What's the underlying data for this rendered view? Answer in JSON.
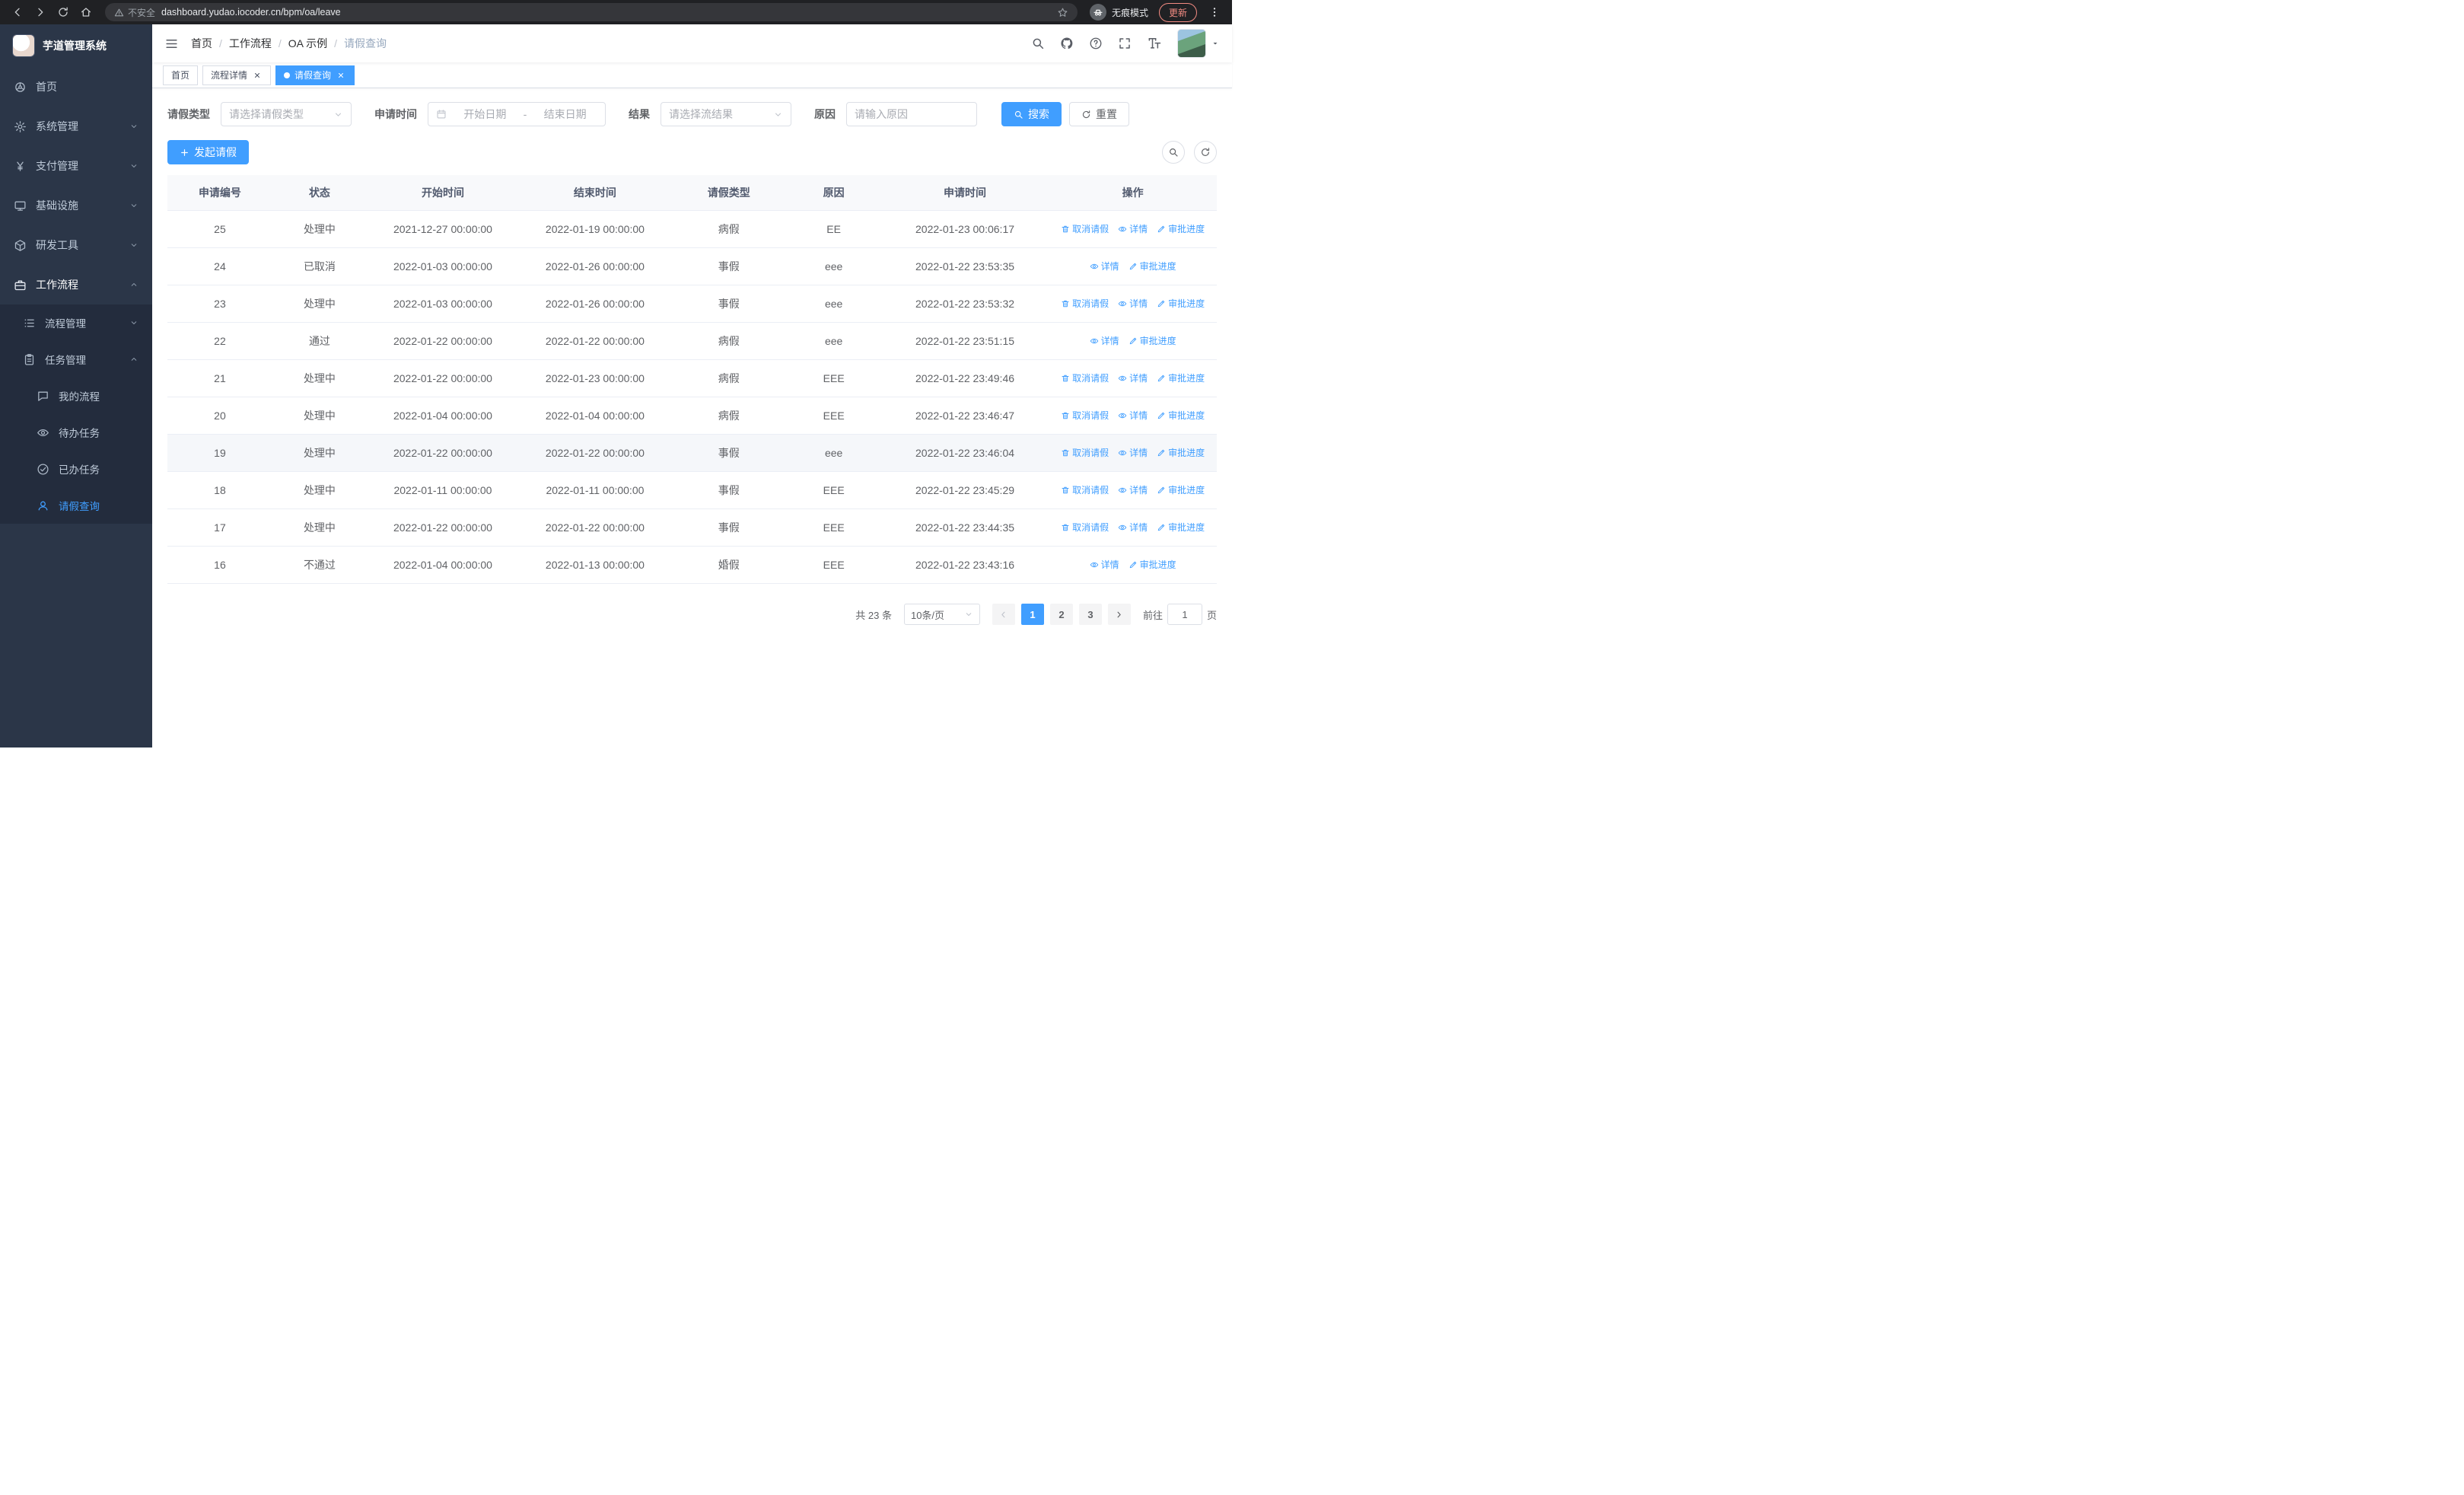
{
  "browser": {
    "security_label": "不安全",
    "url": "dashboard.yudao.iocoder.cn/bpm/oa/leave",
    "incognito_label": "无痕模式",
    "update_label": "更新"
  },
  "sidebar": {
    "title": "芋道管理系统",
    "items": [
      {
        "key": "home",
        "label": "首页",
        "icon": "wheel"
      },
      {
        "key": "system",
        "label": "系统管理",
        "icon": "gear",
        "chevron": "down"
      },
      {
        "key": "payment",
        "label": "支付管理",
        "icon": "yen",
        "chevron": "down"
      },
      {
        "key": "infra",
        "label": "基础设施",
        "icon": "monitor",
        "chevron": "down"
      },
      {
        "key": "devtools",
        "label": "研发工具",
        "icon": "box",
        "chevron": "down"
      },
      {
        "key": "workflow",
        "label": "工作流程",
        "icon": "briefcase",
        "chevron": "up",
        "open": true
      }
    ],
    "submenu": [
      {
        "key": "process-mgmt",
        "label": "流程管理",
        "icon": "list",
        "level": 2,
        "chevron": "down"
      },
      {
        "key": "task-mgmt",
        "label": "任务管理",
        "icon": "clipboard",
        "level": 2,
        "chevron": "up"
      },
      {
        "key": "my-process",
        "label": "我的流程",
        "icon": "chat",
        "level": 3
      },
      {
        "key": "todo-tasks",
        "label": "待办任务",
        "icon": "eye",
        "level": 3
      },
      {
        "key": "done-tasks",
        "label": "已办任务",
        "icon": "check",
        "level": 3
      },
      {
        "key": "leave-query",
        "label": "请假查询",
        "icon": "user",
        "level": 3,
        "active": true
      }
    ]
  },
  "header": {
    "breadcrumbs": [
      "首页",
      "工作流程",
      "OA 示例",
      "请假查询"
    ],
    "separator": "/"
  },
  "tabs": [
    {
      "key": "home",
      "label": "首页",
      "closable": false,
      "active": false
    },
    {
      "key": "process-detail",
      "label": "流程详情",
      "closable": true,
      "active": false
    },
    {
      "key": "leave-query",
      "label": "请假查询",
      "closable": true,
      "active": true
    }
  ],
  "filters": {
    "leave_type_label": "请假类型",
    "leave_type_placeholder": "请选择请假类型",
    "apply_time_label": "申请时间",
    "start_date_placeholder": "开始日期",
    "range_separator": "-",
    "end_date_placeholder": "结束日期",
    "result_label": "结果",
    "result_placeholder": "请选择流结果",
    "reason_label": "原因",
    "reason_placeholder": "请输入原因",
    "search_label": "搜索",
    "reset_label": "重置"
  },
  "toolbar": {
    "create_label": "发起请假"
  },
  "table": {
    "columns": [
      "申请编号",
      "状态",
      "开始时间",
      "结束时间",
      "请假类型",
      "原因",
      "申请时间",
      "操作"
    ],
    "action_labels": {
      "cancel": "取消请假",
      "detail": "详情",
      "progress": "审批进度"
    },
    "rows": [
      {
        "id": "25",
        "status": "处理中",
        "start": "2021-12-27 00:00:00",
        "end": "2022-01-19 00:00:00",
        "type": "病假",
        "reason": "EE",
        "applied": "2022-01-23 00:06:17",
        "actions": [
          "cancel",
          "detail",
          "progress"
        ],
        "highlight": false
      },
      {
        "id": "24",
        "status": "已取消",
        "start": "2022-01-03 00:00:00",
        "end": "2022-01-26 00:00:00",
        "type": "事假",
        "reason": "eee",
        "applied": "2022-01-22 23:53:35",
        "actions": [
          "detail",
          "progress"
        ],
        "highlight": false
      },
      {
        "id": "23",
        "status": "处理中",
        "start": "2022-01-03 00:00:00",
        "end": "2022-01-26 00:00:00",
        "type": "事假",
        "reason": "eee",
        "applied": "2022-01-22 23:53:32",
        "actions": [
          "cancel",
          "detail",
          "progress"
        ],
        "highlight": false
      },
      {
        "id": "22",
        "status": "通过",
        "start": "2022-01-22 00:00:00",
        "end": "2022-01-22 00:00:00",
        "type": "病假",
        "reason": "eee",
        "applied": "2022-01-22 23:51:15",
        "actions": [
          "detail",
          "progress"
        ],
        "highlight": false
      },
      {
        "id": "21",
        "status": "处理中",
        "start": "2022-01-22 00:00:00",
        "end": "2022-01-23 00:00:00",
        "type": "病假",
        "reason": "EEE",
        "applied": "2022-01-22 23:49:46",
        "actions": [
          "cancel",
          "detail",
          "progress"
        ],
        "highlight": false
      },
      {
        "id": "20",
        "status": "处理中",
        "start": "2022-01-04 00:00:00",
        "end": "2022-01-04 00:00:00",
        "type": "病假",
        "reason": "EEE",
        "applied": "2022-01-22 23:46:47",
        "actions": [
          "cancel",
          "detail",
          "progress"
        ],
        "highlight": false
      },
      {
        "id": "19",
        "status": "处理中",
        "start": "2022-01-22 00:00:00",
        "end": "2022-01-22 00:00:00",
        "type": "事假",
        "reason": "eee",
        "applied": "2022-01-22 23:46:04",
        "actions": [
          "cancel",
          "detail",
          "progress"
        ],
        "highlight": true
      },
      {
        "id": "18",
        "status": "处理中",
        "start": "2022-01-11 00:00:00",
        "end": "2022-01-11 00:00:00",
        "type": "事假",
        "reason": "EEE",
        "applied": "2022-01-22 23:45:29",
        "actions": [
          "cancel",
          "detail",
          "progress"
        ],
        "highlight": false
      },
      {
        "id": "17",
        "status": "处理中",
        "start": "2022-01-22 00:00:00",
        "end": "2022-01-22 00:00:00",
        "type": "事假",
        "reason": "EEE",
        "applied": "2022-01-22 23:44:35",
        "actions": [
          "cancel",
          "detail",
          "progress"
        ],
        "highlight": false
      },
      {
        "id": "16",
        "status": "不通过",
        "start": "2022-01-04 00:00:00",
        "end": "2022-01-13 00:00:00",
        "type": "婚假",
        "reason": "EEE",
        "applied": "2022-01-22 23:43:16",
        "actions": [
          "detail",
          "progress"
        ],
        "highlight": false
      }
    ]
  },
  "pagination": {
    "total_text": "共 23 条",
    "page_size_text": "10条/页",
    "pages": [
      "1",
      "2",
      "3"
    ],
    "active_page": "1",
    "goto_prefix": "前往",
    "goto_value": "1",
    "goto_suffix": "页"
  },
  "colors": {
    "accent": "#409eff",
    "sidebar_bg": "#2b3648",
    "submenu_bg": "#232c3d"
  }
}
